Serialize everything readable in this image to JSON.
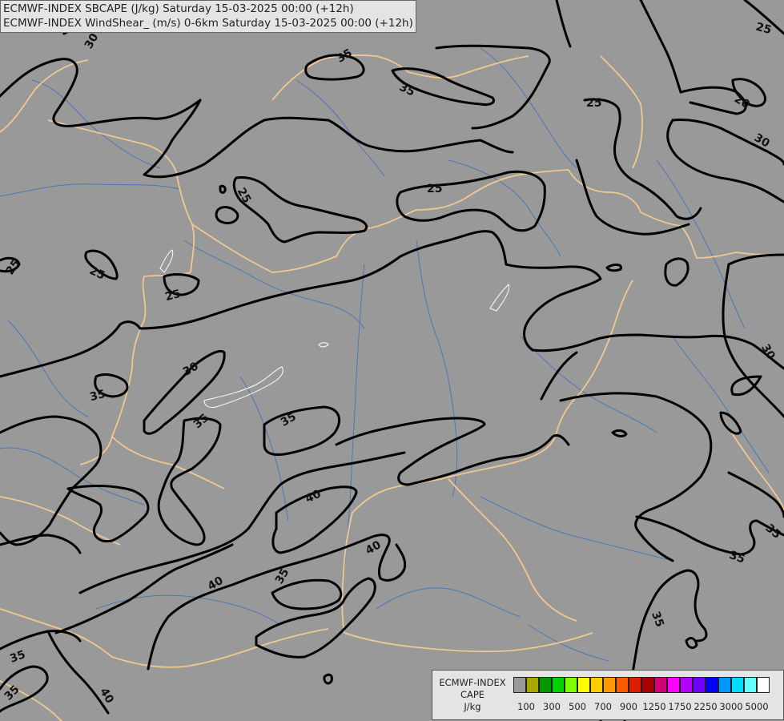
{
  "header": {
    "line1": "ECMWF-INDEX SBCAPE (J/kg) Saturday 15-03-2025 00:00 (+12h)",
    "line2": "ECMWF-INDEX WindShear_ (m/s) 0-6km Saturday 15-03-2025 00:00 (+12h)"
  },
  "map": {
    "background_color": "#999999",
    "border_color": "#f0c890",
    "river_color": "#4a78b8",
    "contour_color": "#000000",
    "contour_labels": [
      "30",
      "35",
      "35",
      "25",
      "20",
      "25",
      "25",
      "25",
      "30",
      "25",
      "25",
      "25",
      "30",
      "35",
      "35",
      "35",
      "30",
      "40",
      "40",
      "35",
      "40",
      "35",
      "35",
      "35",
      "35",
      "35",
      "40",
      "35",
      "35"
    ]
  },
  "legend": {
    "title_line1": "ECMWF-INDEX",
    "title_line2": "CAPE",
    "title_line3": "J/kg",
    "colors": [
      "#999999",
      "#a8a800",
      "#009600",
      "#00d200",
      "#7dff00",
      "#ffff00",
      "#ffcc00",
      "#ff9900",
      "#ff5a00",
      "#dc1e00",
      "#aa0000",
      "#d20078",
      "#ff00ff",
      "#b400ff",
      "#6e00ff",
      "#0000ff",
      "#0096ff",
      "#00dcff",
      "#64ffff",
      "#ffffff"
    ],
    "ticks": [
      "100",
      "300",
      "500",
      "700",
      "900",
      "1250",
      "1750",
      "2250",
      "3000",
      "5000"
    ]
  }
}
